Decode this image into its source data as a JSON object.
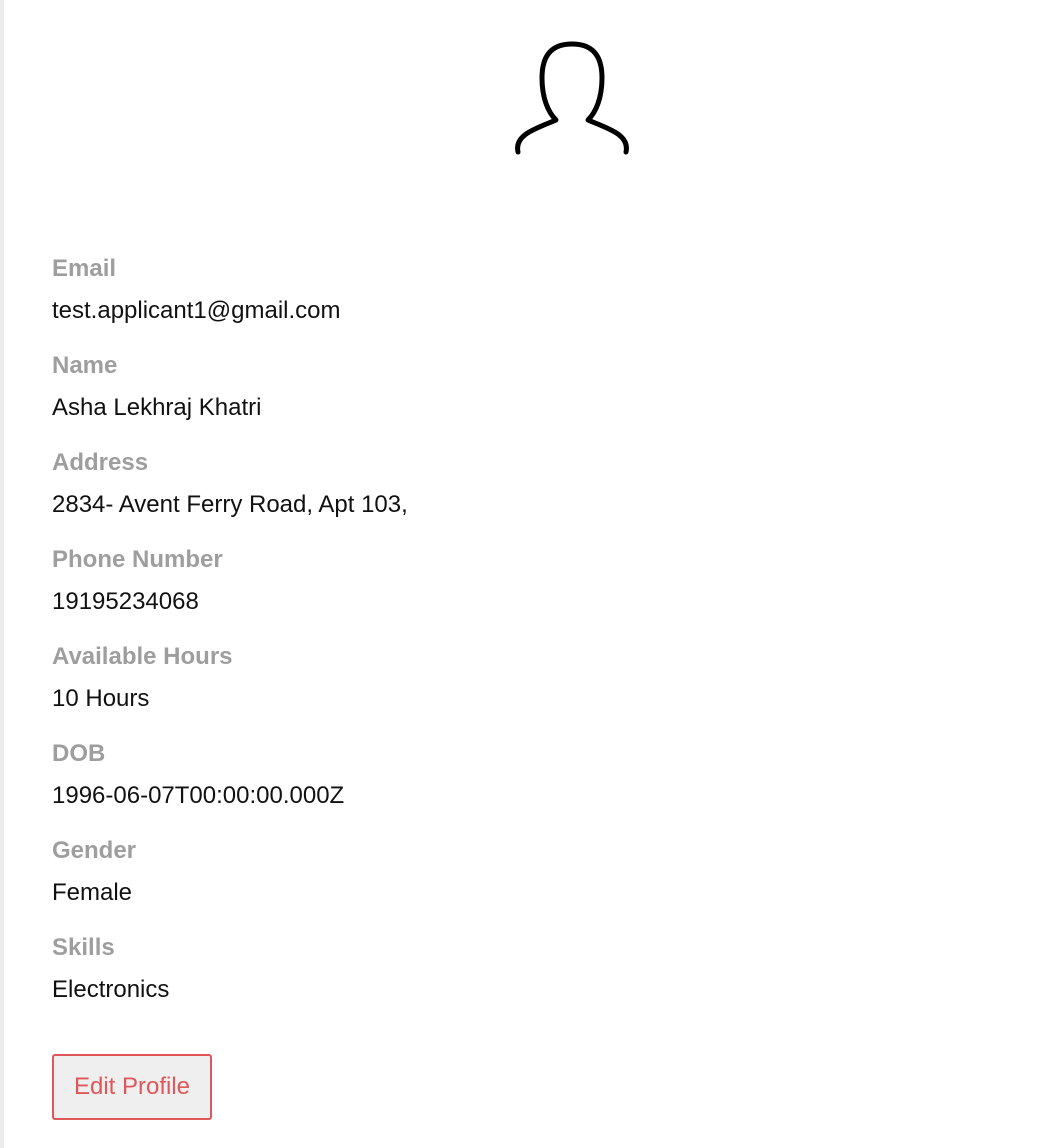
{
  "profile": {
    "avatar_icon": "user-outline-icon",
    "fields": [
      {
        "label": "Email",
        "value": "test.applicant1@gmail.com"
      },
      {
        "label": "Name",
        "value": "Asha Lekhraj Khatri"
      },
      {
        "label": "Address",
        "value": "2834- Avent Ferry Road, Apt 103,"
      },
      {
        "label": "Phone Number",
        "value": "19195234068"
      },
      {
        "label": "Available Hours",
        "value": "10 Hours"
      },
      {
        "label": "DOB",
        "value": "1996-06-07T00:00:00.000Z"
      },
      {
        "label": "Gender",
        "value": "Female"
      },
      {
        "label": "Skills",
        "value": "Electronics"
      }
    ],
    "edit_label": "Edit Profile"
  },
  "colors": {
    "label": "#9e9e9e",
    "value": "#111111",
    "accent": "#e0575a",
    "button_bg": "#efefef"
  }
}
